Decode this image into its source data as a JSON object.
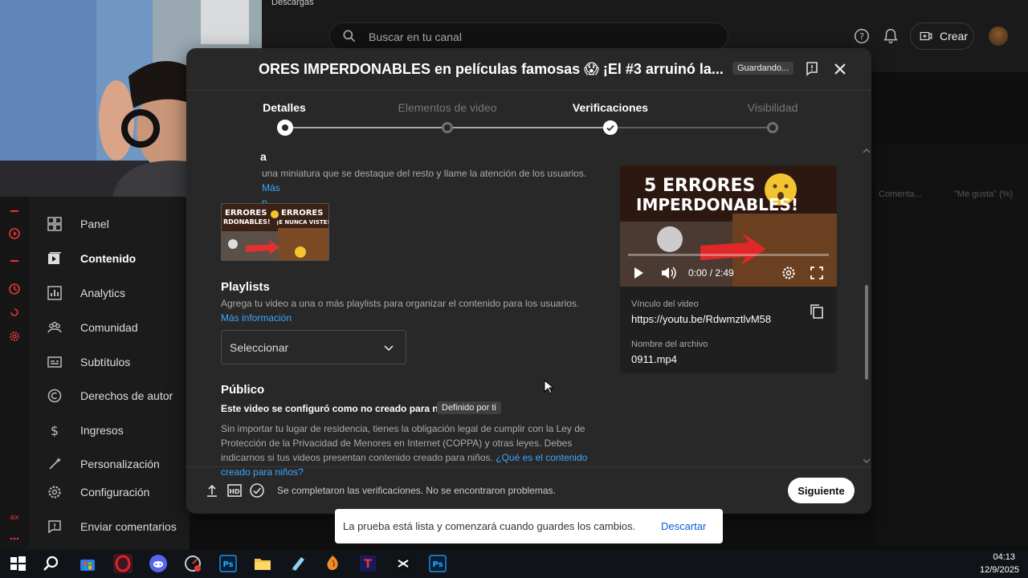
{
  "header": {
    "downloads_label": "Descargas",
    "search_placeholder": "Buscar en tu canal",
    "create_label": "Crear",
    "icons": [
      "search-icon",
      "help-icon",
      "bell-icon",
      "create-video-icon"
    ]
  },
  "sidebar": {
    "items": [
      {
        "label": "Panel",
        "icon": "dashboard-icon"
      },
      {
        "label": "Contenido",
        "icon": "content-icon",
        "active": true
      },
      {
        "label": "Analytics",
        "icon": "analytics-icon"
      },
      {
        "label": "Comunidad",
        "icon": "community-icon"
      },
      {
        "label": "Subtítulos",
        "icon": "subtitles-icon"
      },
      {
        "label": "Derechos de autor",
        "icon": "copyright-icon"
      },
      {
        "label": "Ingresos",
        "icon": "dollar-icon"
      },
      {
        "label": "Personalización",
        "icon": "wand-icon"
      },
      {
        "label": "Configuración",
        "icon": "gear-icon"
      },
      {
        "label": "Enviar comentarios",
        "icon": "feedback-icon"
      }
    ]
  },
  "background_table": {
    "col_comments": "Comenta...",
    "col_likes": "\"Me gusta\" (%)"
  },
  "modal": {
    "title": "ORES IMPERDONABLES en películas famosas 😱 ¡El #3 arruinó la...",
    "saving_badge": "Guardando...",
    "steps": [
      {
        "label": "Detalles",
        "state": "current"
      },
      {
        "label": "Elementos de video",
        "state": "pending"
      },
      {
        "label": "Verificaciones",
        "state": "done"
      },
      {
        "label": "Visibilidad",
        "state": "pending"
      }
    ],
    "thumbnail": {
      "heading": "a",
      "description": "una miniatura que se destaque del resto y llame la atención de los usuarios.",
      "more_link": "Más",
      "more_link_2": "n",
      "image_texts": [
        "ERRORES",
        "RDONABLES!",
        "ERRORES",
        "¡E NUNCA VISTE!"
      ]
    },
    "playlists": {
      "heading": "Playlists",
      "description": "Agrega tu video a una o más playlists para organizar el contenido para los usuarios.",
      "more_link": "Más información",
      "select_value": "Seleccionar"
    },
    "audience": {
      "heading": "Público",
      "status": "Este video se configuró como no creado para niños",
      "badge": "Definido por ti",
      "description": "Sin importar tu lugar de residencia, tienes la obligación legal de cumplir con la Ley de Protección de la Privacidad de Menores en Internet (COPPA) y otras leyes. Debes indicarnos si tus videos presentan contenido creado para niños.",
      "link": "¿Qué es el contenido creado para niños?"
    },
    "preview": {
      "overlay_line1": "5 ERRORES",
      "overlay_line2": "IMPERDONABLES!",
      "time": "0:00 / 2:49",
      "link_label": "Vínculo del video",
      "link_value": "https://youtu.be/RdwmztlvM58",
      "file_label": "Nombre del archivo",
      "file_value": "0911.mp4"
    },
    "footer": {
      "status": "Se completaron las verificaciones. No se encontraron problemas.",
      "next_label": "Siguiente"
    }
  },
  "toast": {
    "message": "La prueba está lista y comenzará cuando guardes los cambios.",
    "action": "Descartar"
  },
  "taskbar": {
    "time": "04:13",
    "date": "12/9/2025"
  },
  "colors": {
    "link": "#3ea6ff",
    "modal_bg": "#282828",
    "page_bg": "#0f0f0f"
  }
}
